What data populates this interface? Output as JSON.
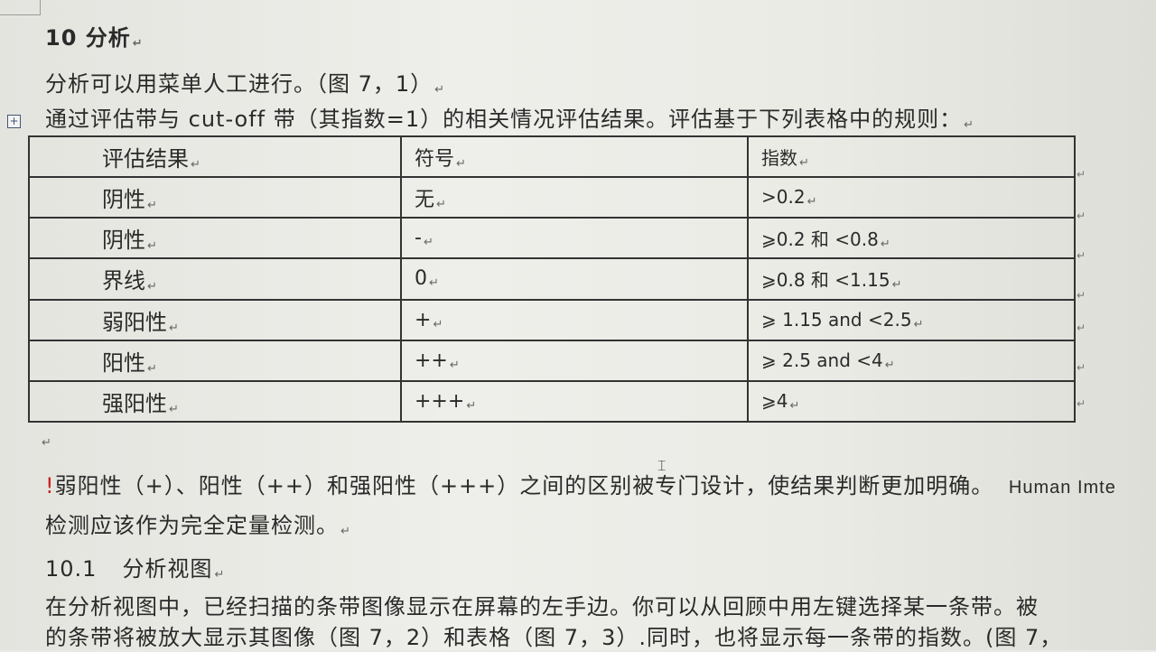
{
  "heading": {
    "text": "10 分析"
  },
  "paragraph1": "分析可以用菜单人工进行。（图 7，1）",
  "paragraph2": "通过评估带与 cut-off 带（其指数=1）的相关情况评估结果。评估基于下列表格中的规则：",
  "table": {
    "headers": [
      "评估结果",
      "符号",
      "指数"
    ],
    "rows": [
      [
        "阴性",
        "无",
        ">0.2"
      ],
      [
        "阴性",
        "-",
        "⩾0.2 和 <0.8"
      ],
      [
        "界线",
        "0",
        "⩾0.8 和 <1.15"
      ],
      [
        "弱阳性",
        "+",
        "⩾ 1.15 and <2.5"
      ],
      [
        "阳性",
        "++",
        "⩾ 2.5 and <4"
      ],
      [
        "强阳性",
        "+++",
        "⩾4"
      ]
    ]
  },
  "paragraph3": {
    "bang": "!",
    "text": "弱阳性（+）、阳性（++）和强阳性（+++）之间的区别被专门设计，使结果判断更加明确。",
    "trailing": "Human Imte"
  },
  "paragraph4": "检测应该作为完全定量检测。",
  "subheading": {
    "number": "10.1",
    "title": "分析视图"
  },
  "paragraph5": "在分析视图中，已经扫描的条带图像显示在屏幕的左手边。你可以从回顾中用左键选择某一条带。被",
  "paragraph6": "的条带将被放大显示其图像（图 7，2）和表格（图 7，3）.同时，也将显示每一条带的指数。(图 7，",
  "marks": {
    "paragraph": "↵",
    "cell_end": "↵"
  },
  "icons": {
    "table_move_handle": "table-move-icon"
  }
}
